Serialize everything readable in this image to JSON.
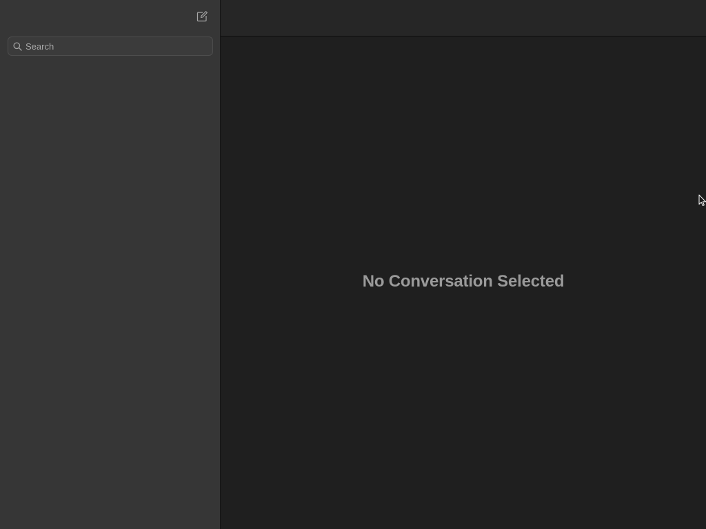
{
  "sidebar": {
    "compose_icon": "compose-icon",
    "search": {
      "icon": "magnifier-icon",
      "placeholder": "Search",
      "value": ""
    },
    "conversations": []
  },
  "main": {
    "empty_state": "No Conversation Selected"
  },
  "colors": {
    "sidebar_bg": "#363636",
    "main_bg": "#1f1f1f",
    "toolbar_bg": "#262626",
    "empty_text": "#9a9a9a"
  }
}
